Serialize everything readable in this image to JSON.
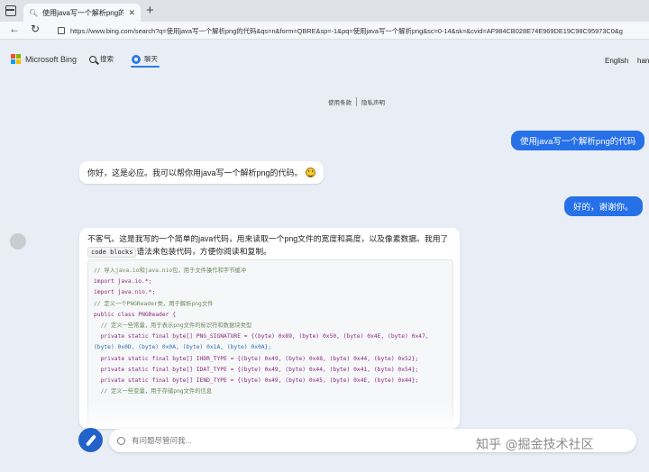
{
  "browser": {
    "tab_title": "使用java写一个解析png的代码...",
    "url": "https://www.bing.com/search?q=使用java写一个解析png的代码&qs=n&form=QBRE&sp=-1&pq=使用java写一个解析png&sc=0-14&sk=&cvid=AF984CB028E74E969DE19C98C95973C0&g"
  },
  "header": {
    "brand": "Microsoft Bing",
    "nav_search": "搜索",
    "nav_chat": "聊天",
    "language": "English",
    "user": "han"
  },
  "links": {
    "terms": "使用条款",
    "privacy": "隐私声明"
  },
  "messages": {
    "user1": "使用java写一个解析png的代码",
    "bot1": "你好，这是必应。我可以帮你用java写一个解析png的代码。",
    "user2": "好的，谢谢你。",
    "bot2_intro_a": "不客气。这是我写的一个简单的java代码，用来读取一个png文件的宽度和高度，以及像素数据。我用了",
    "bot2_inline_code": "code blocks",
    "bot2_intro_b": "语法来包装代码，方便你阅读和复制。"
  },
  "code": {
    "l1": "// 导入java.io和java.nio包，用于文件操作和字节缓冲",
    "l2": "import java.io.*;",
    "l3": "import java.nio.*;",
    "l4": "",
    "l5": "// 定义一个PNGReader类，用于解析png文件",
    "l6": "public class PNGReader {",
    "l7": "",
    "l8": "  // 定义一些常量，用于表示png文件的标识符和数据块类型",
    "l9": "  private static final byte[] PNG_SIGNATURE = {(byte) 0x89, (byte) 0x50, (byte) 0x4E, (byte) 0x47,",
    "l10": "(byte) 0x0D, (byte) 0x0A, (byte) 0x1A, (byte) 0x0A};",
    "l11": "  private static final byte[] IHDR_TYPE = {(byte) 0x49, (byte) 0x48, (byte) 0x44, (byte) 0x52};",
    "l12": "  private static final byte[] IDAT_TYPE = {(byte) 0x49, (byte) 0x44, (byte) 0x41, (byte) 0x54};",
    "l13": "  private static final byte[] IEND_TYPE = {(byte) 0x49, (byte) 0x45, (byte) 0x4E, (byte) 0x44};",
    "l14": "",
    "l15": "  // 定义一些变量，用于存储png文件的信息"
  },
  "input": {
    "placeholder": "有问题尽管问我..."
  },
  "watermark": "知乎 @掘金技术社区",
  "colors": {
    "accent": "#2670e8",
    "background": "#e9eef6"
  }
}
